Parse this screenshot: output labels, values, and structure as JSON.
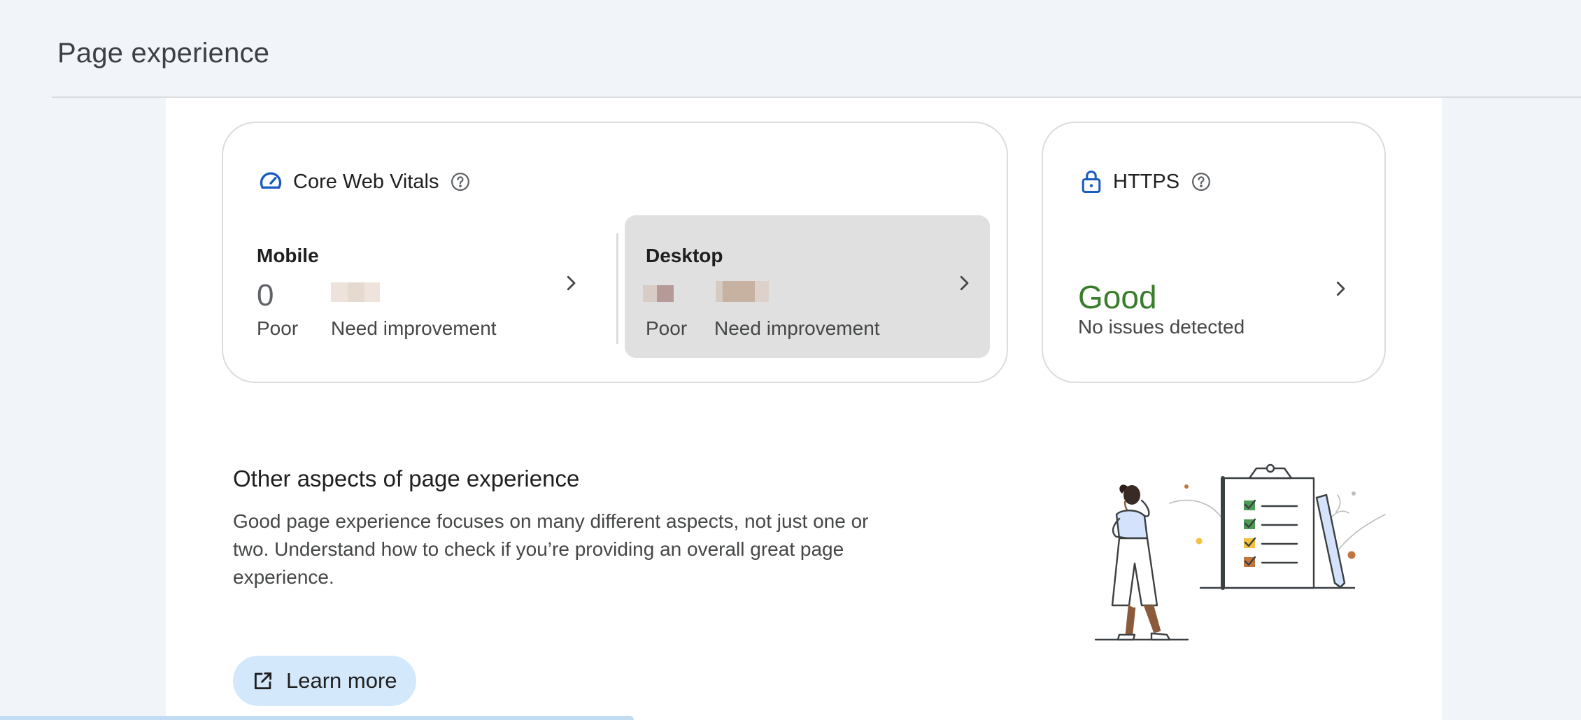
{
  "page": {
    "title": "Page experience"
  },
  "core_web_vitals": {
    "title": "Core Web Vitals",
    "mobile": {
      "label": "Mobile",
      "poor_value": "0",
      "poor_label": "Poor",
      "need_improvement_label": "Need improvement"
    },
    "desktop": {
      "label": "Desktop",
      "poor_label": "Poor",
      "need_improvement_label": "Need improvement"
    }
  },
  "https": {
    "title": "HTTPS",
    "status": "Good",
    "subtitle": "No issues detected"
  },
  "other_aspects": {
    "title": "Other aspects of page experience",
    "description": "Good page experience focuses on many different aspects, not just one or two. Understand how to check if you’re providing an overall great page experience.",
    "learn_more_label": "Learn more"
  },
  "colors": {
    "accent_blue": "#1a5bbf",
    "good_green": "#3a7d2c",
    "button_bg": "#d3e8fb",
    "selected_bg": "#e0e0e0"
  },
  "icons": {
    "cwv": "speedometer-icon",
    "https": "lock-icon",
    "help": "help-circle-icon",
    "chevron": "chevron-right-icon",
    "external": "open-in-new-icon"
  }
}
